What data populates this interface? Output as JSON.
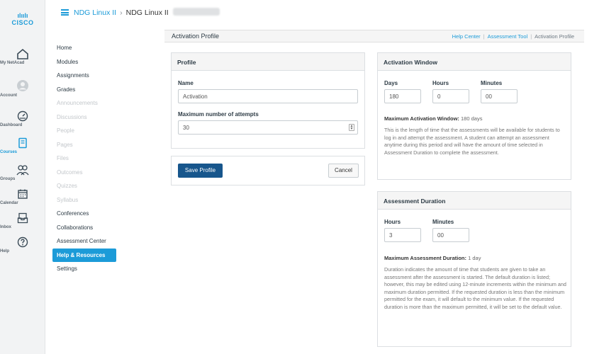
{
  "rail": {
    "brand_bars": "ılıılı",
    "brand_word": "CISCO",
    "items": [
      {
        "label": "My NetAcad",
        "icon": "home-icon"
      },
      {
        "label": "Account",
        "icon": "account-icon"
      },
      {
        "label": "Dashboard",
        "icon": "dashboard-icon"
      },
      {
        "label": "Courses",
        "icon": "courses-icon"
      },
      {
        "label": "Groups",
        "icon": "groups-icon"
      },
      {
        "label": "Calendar",
        "icon": "calendar-icon"
      },
      {
        "label": "Inbox",
        "icon": "inbox-icon"
      },
      {
        "label": "Help",
        "icon": "help-icon"
      }
    ]
  },
  "header": {
    "crumb_course_link": "NDG Linux II",
    "crumb_separator": "›",
    "crumb_course": "NDG Linux II"
  },
  "course_nav": [
    {
      "label": "Home",
      "state": "normal"
    },
    {
      "label": "Modules",
      "state": "normal"
    },
    {
      "label": "Assignments",
      "state": "normal"
    },
    {
      "label": "Grades",
      "state": "normal"
    },
    {
      "label": "Announcements",
      "state": "disabled"
    },
    {
      "label": "Discussions",
      "state": "disabled"
    },
    {
      "label": "People",
      "state": "disabled"
    },
    {
      "label": "Pages",
      "state": "disabled"
    },
    {
      "label": "Files",
      "state": "disabled"
    },
    {
      "label": "Outcomes",
      "state": "disabled"
    },
    {
      "label": "Quizzes",
      "state": "disabled"
    },
    {
      "label": "Syllabus",
      "state": "disabled"
    },
    {
      "label": "Conferences",
      "state": "normal"
    },
    {
      "label": "Collaborations",
      "state": "normal"
    },
    {
      "label": "Assessment Center",
      "state": "normal"
    },
    {
      "label": "Help & Resources",
      "state": "active"
    },
    {
      "label": "Settings",
      "state": "normal"
    }
  ],
  "page": {
    "title": "Activation Profile",
    "breadcrumb": {
      "help_center": "Help Center",
      "assessment_tool": "Assessment Tool",
      "current": "Activation Profile"
    }
  },
  "profile": {
    "heading": "Profile",
    "name_label": "Name",
    "name_value": "Activation",
    "attempts_label": "Maximum number of attempts",
    "attempts_value": "30",
    "save_label": "Save Profile",
    "cancel_label": "Cancel"
  },
  "activation_window": {
    "heading": "Activation Window",
    "days_label": "Days",
    "days_value": "180",
    "hours_label": "Hours",
    "hours_value": "0",
    "minutes_label": "Minutes",
    "minutes_value": "00",
    "max_label": "Maximum Activation Window:",
    "max_value": "180 days",
    "description": "This is the length of time that the assessments will be available for students to log in and attempt the assessment. A student can attempt an assessment anytime during this period and will have the amount of time selected in Assessment Duration to complete the assessment."
  },
  "assessment_duration": {
    "heading": "Assessment Duration",
    "hours_label": "Hours",
    "hours_value": "3",
    "minutes_label": "Minutes",
    "minutes_value": "00",
    "max_label": "Maximum Assessment Duration:",
    "max_value": "1 day",
    "description": "Duration indicates the amount of time that students are given to take an assessment after the assessment is started. The default duration is listed; however, this may be edited using 12-minute increments within the minimum and maximum duration permitted. If the requested duration is less than the minimum permitted for the exam, it will default to the minimum value. If the requested duration is more than the maximum permitted, it will be set to the default value."
  },
  "colors": {
    "accent": "#1c9bd8",
    "primary_button": "#17568c",
    "rail_bg": "#f2f3f4"
  }
}
